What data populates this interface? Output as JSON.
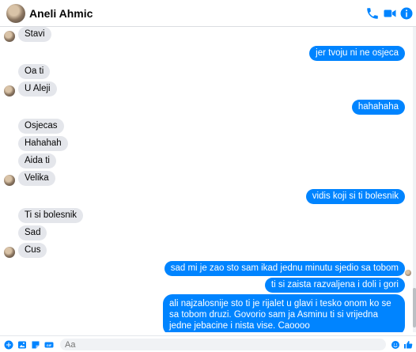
{
  "header": {
    "contact_name": "Aneli Ahmic"
  },
  "messages": [
    {
      "dir": "in",
      "text": "Stavi"
    },
    {
      "dir": "out",
      "text": "jer tvoju ni ne osjeca"
    },
    {
      "dir": "in",
      "text": "Oa ti"
    },
    {
      "dir": "in",
      "text": "U Aleji"
    },
    {
      "dir": "out",
      "text": "hahahaha"
    },
    {
      "dir": "in",
      "text": "Osjecas"
    },
    {
      "dir": "in",
      "text": "Hahahah"
    },
    {
      "dir": "in",
      "text": "Aida ti"
    },
    {
      "dir": "in",
      "text": "Velika"
    },
    {
      "dir": "out",
      "text": "vidis koji si ti bolesnik"
    },
    {
      "dir": "in",
      "text": "Ti si bolesnik"
    },
    {
      "dir": "in",
      "text": "Sad"
    },
    {
      "dir": "in",
      "text": "Cus"
    },
    {
      "dir": "out",
      "text": "sad mi je zao sto sam ikad jednu minutu sjedio sa tobom"
    },
    {
      "dir": "out",
      "text": "ti si zaista razvaljena i doli i gori"
    },
    {
      "dir": "out",
      "text": "ali najzalosnije sto ti je rijalet u glavi i tesko onom ko se sa tobom druzi. Govorio sam ja Asminu ti si vrijedna jedne jebacine i nista vise. Caoooo"
    }
  ],
  "composer": {
    "placeholder": "Aa"
  },
  "colors": {
    "accent": "#0084ff",
    "incoming_bubble": "#e4e6eb"
  },
  "icons": [
    "phone-icon",
    "video-icon",
    "info-icon",
    "plus-icon",
    "image-icon",
    "sticker-icon",
    "gif-icon",
    "emoji-icon",
    "like-icon"
  ]
}
